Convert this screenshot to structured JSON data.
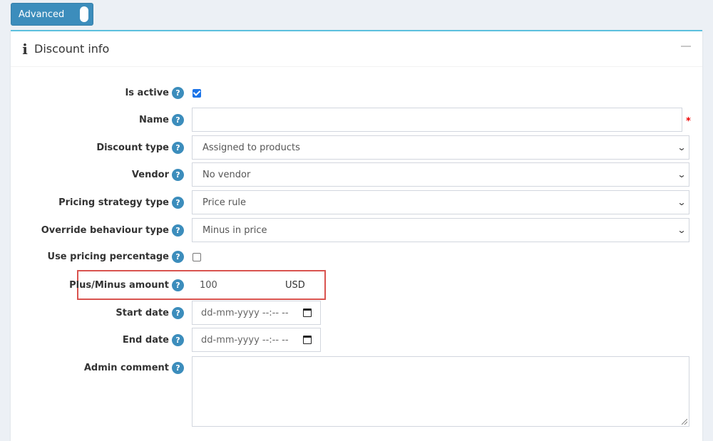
{
  "toolbar": {
    "advanced_label": "Advanced"
  },
  "card": {
    "title": "Discount info",
    "collapse_icon": "minus-icon"
  },
  "fields": {
    "is_active": {
      "label": "Is active",
      "checked": true
    },
    "name": {
      "label": "Name",
      "value": "",
      "required_mark": "*"
    },
    "discount_type": {
      "label": "Discount type",
      "value": "Assigned to products"
    },
    "vendor": {
      "label": "Vendor",
      "value": "No vendor"
    },
    "pricing_strategy": {
      "label": "Pricing strategy type",
      "value": "Price rule"
    },
    "override_behaviour": {
      "label": "Override behaviour type",
      "value": "Minus in price"
    },
    "use_pricing_percentage": {
      "label": "Use pricing percentage",
      "checked": false
    },
    "plus_minus_amount": {
      "label": "Plus/Minus amount",
      "value": "100",
      "currency": "USD"
    },
    "start_date": {
      "label": "Start date",
      "placeholder": "dd-mm-yyyy --:-- --"
    },
    "end_date": {
      "label": "End date",
      "placeholder": "dd-mm-yyyy --:-- --"
    },
    "admin_comment": {
      "label": "Admin comment",
      "value": ""
    }
  },
  "help_glyph": "?",
  "colors": {
    "accent": "#3c8dbc",
    "highlight": "#d9534f",
    "card_top": "#5bc0de"
  }
}
